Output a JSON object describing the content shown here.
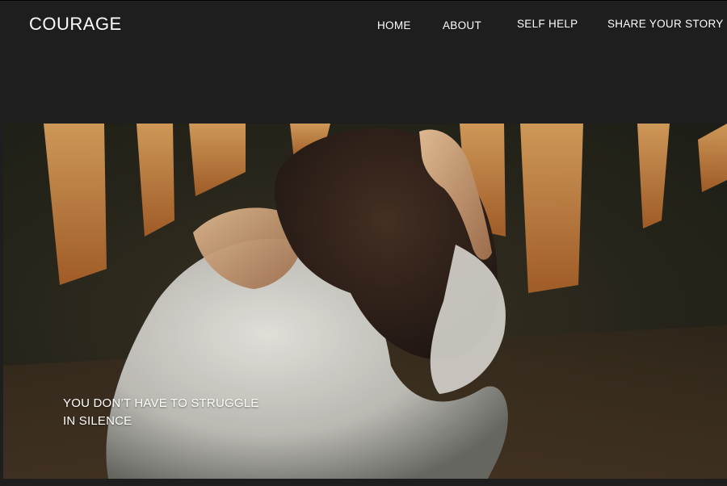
{
  "brand": {
    "name": "COURAGE"
  },
  "nav": {
    "items": [
      {
        "label": "HOME"
      },
      {
        "label": "ABOUT"
      },
      {
        "label": "SELF HELP"
      },
      {
        "label": "SHARE YOUR STORY"
      }
    ]
  },
  "hero": {
    "image_subject": "woman-holding-head-photo",
    "tagline_line1": "YOU DON’T HAVE TO STRUGGLE",
    "tagline_line2": "IN SILENCE"
  },
  "colors": {
    "page_background": "#1e1e1e",
    "text": "#ffffff",
    "light_stripes": "#e8a258",
    "shadow_wall": "#3a3022"
  }
}
